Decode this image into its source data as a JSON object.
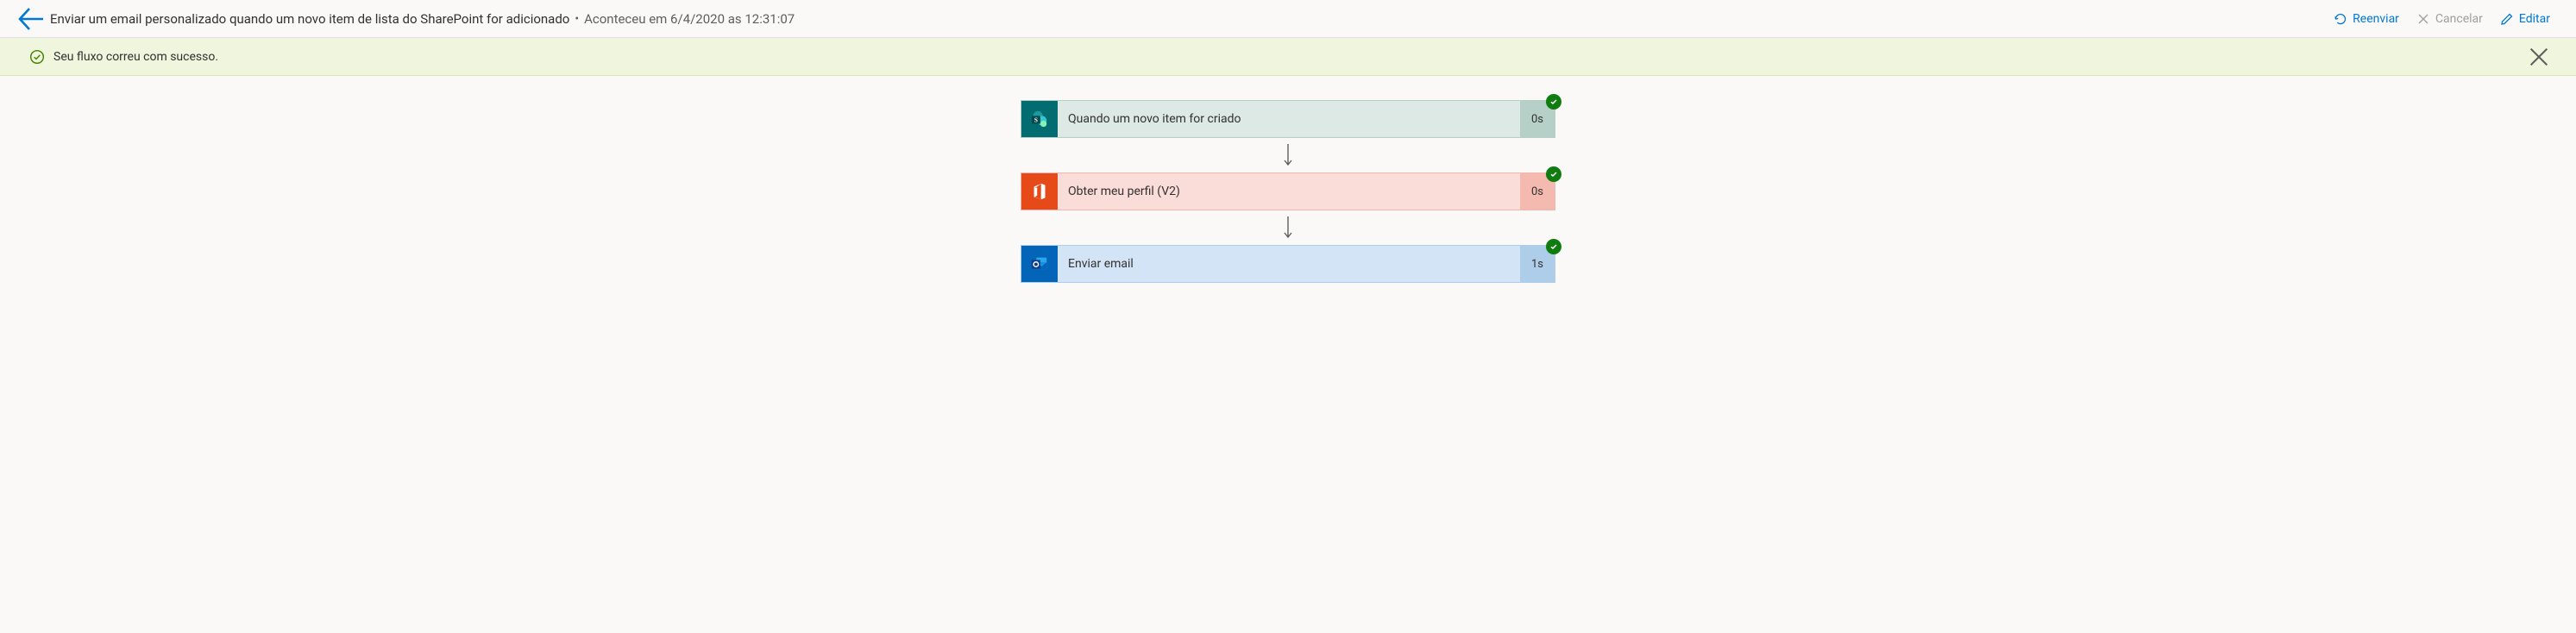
{
  "header": {
    "title": "Enviar um email personalizado quando um novo item de lista do SharePoint for adicionado",
    "timestamp": "Aconteceu em 6/4/2020 as 12:31:07",
    "resend_label": "Reenviar",
    "cancel_label": "Cancelar",
    "edit_label": "Editar"
  },
  "banner": {
    "message": "Seu fluxo correu com sucesso."
  },
  "steps": [
    {
      "label": "Quando um novo item for criado",
      "time": "0s"
    },
    {
      "label": "Obter meu perfil (V2)",
      "time": "0s"
    },
    {
      "label": "Enviar email",
      "time": "1s"
    }
  ]
}
